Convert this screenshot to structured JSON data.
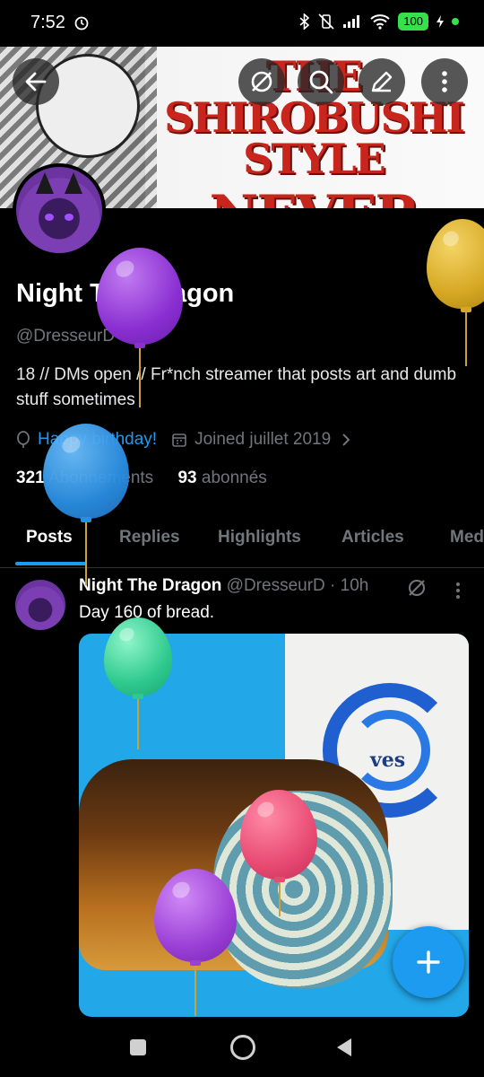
{
  "status_bar": {
    "time": "7:52",
    "battery": "100"
  },
  "banner": {
    "line1": "THE SHIROBUSHI STYLE",
    "line2": "NEVER LOSES"
  },
  "profile": {
    "name": "Night The Dragon",
    "handle": "@DresseurD",
    "bio": "18 // DMs open // Fr*nch streamer that posts art and dumb stuff sometimes",
    "birthday": "Happy birthday!",
    "joined": "Joined juillet 2019",
    "following_count": "321",
    "following_label": "Abonnements",
    "followers_count": "93",
    "followers_label": "abonnés"
  },
  "tabs": [
    {
      "label": "Posts"
    },
    {
      "label": "Replies"
    },
    {
      "label": "Highlights"
    },
    {
      "label": "Articles"
    },
    {
      "label": "Media"
    }
  ],
  "post": {
    "name": "Night The Dragon",
    "handle": "@DresseurD",
    "time": "· 10h",
    "text": "Day 160 of bread.",
    "image_text": "ves"
  },
  "colors": {
    "accent": "#1d9bf0",
    "background": "#000000",
    "muted": "#71767b"
  },
  "icons": {
    "back": "arrow-left-icon",
    "grok": "grok-slash-icon",
    "search": "search-icon",
    "edit": "pencil-icon",
    "more": "more-vertical-icon",
    "compose": "plus-icon"
  }
}
